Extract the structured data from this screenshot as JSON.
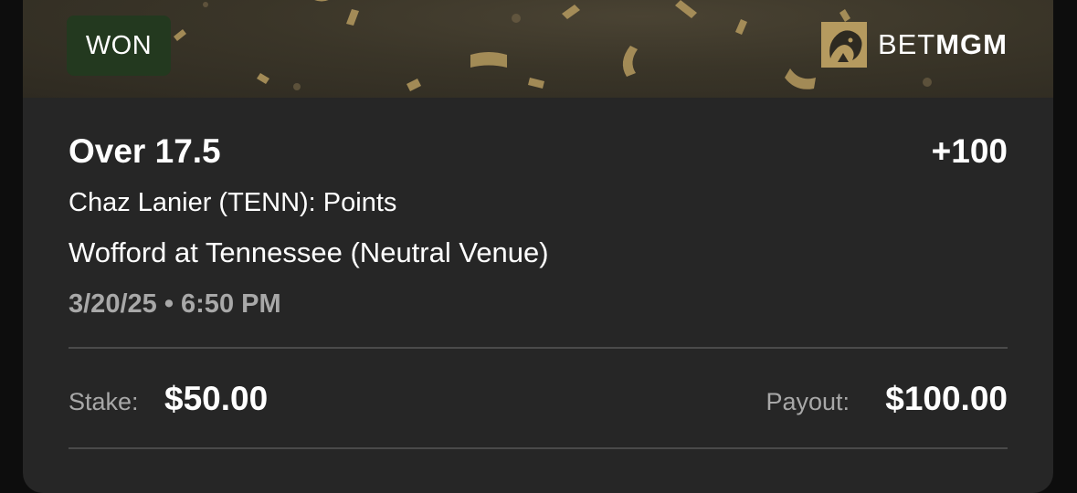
{
  "status_badge": "WON",
  "brand": {
    "name_regular": "BET",
    "name_bold": "MGM",
    "logo_icon": "lion-icon"
  },
  "bet": {
    "selection": "Over 17.5",
    "odds": "+100",
    "market": "Chaz Lanier (TENN): Points",
    "matchup": "Wofford at Tennessee (Neutral Venue)",
    "datetime": "3/20/25 • 6:50 PM"
  },
  "summary": {
    "stake_label": "Stake:",
    "stake_value": "$50.00",
    "payout_label": "Payout:",
    "payout_value": "$100.00"
  },
  "colors": {
    "won_badge_bg": "#23391f",
    "banner_gold": "#c9a96a",
    "card_bg": "#262626"
  }
}
